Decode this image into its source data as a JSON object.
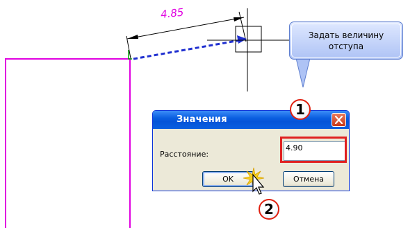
{
  "drawing": {
    "dimension_value": "4.85",
    "line_color": "#e000e0",
    "arrow_color": "#1f2fd0"
  },
  "callout": {
    "text": "Задать величину\nотступа"
  },
  "dialog": {
    "title": "Значения",
    "field_label": "Расстояние:",
    "field_value": "4.90",
    "ok_label": "OK",
    "cancel_label": "Отмена",
    "close_icon": "close-icon"
  },
  "steps": {
    "step1": "1",
    "step2": "2"
  },
  "colors": {
    "highlight": "#e02020",
    "titlebar": "#0a5ee0"
  }
}
